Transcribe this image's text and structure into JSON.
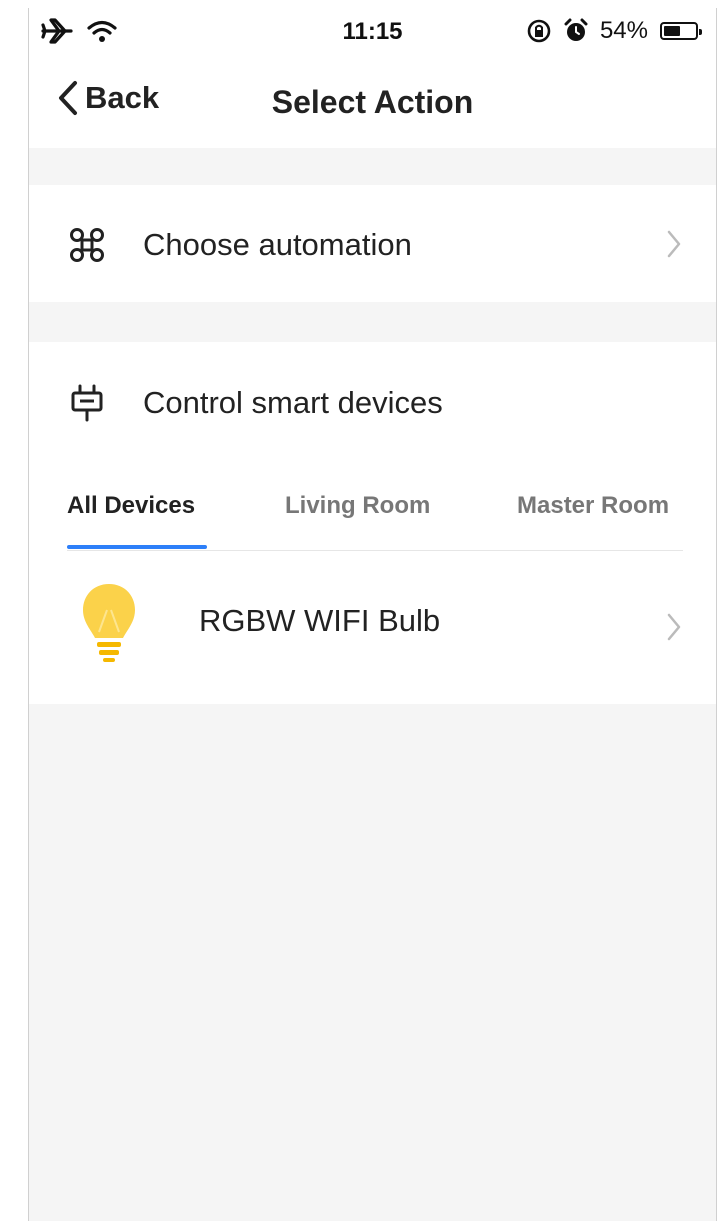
{
  "status_bar": {
    "time": "11:15",
    "battery_percent": "54%",
    "battery_level": 0.54,
    "icons": [
      "airplane-icon",
      "wifi-icon",
      "orientation-lock-icon",
      "alarm-icon",
      "battery-icon"
    ]
  },
  "nav": {
    "back_label": "Back",
    "title": "Select Action"
  },
  "automation": {
    "label": "Choose automation",
    "icon": "command-icon"
  },
  "smart_devices": {
    "label": "Control smart devices",
    "icon": "plug-icon",
    "tabs": [
      {
        "label": "All Devices",
        "active": true
      },
      {
        "label": "Living Room",
        "active": false
      },
      {
        "label": "Master Room",
        "active": false
      }
    ],
    "devices": [
      {
        "name": "RGBW WIFI Bulb",
        "icon": "bulb-icon"
      }
    ]
  },
  "colors": {
    "accent": "#2d7ff9",
    "bulb": "#fbd24a",
    "background": "#f5f5f5"
  }
}
